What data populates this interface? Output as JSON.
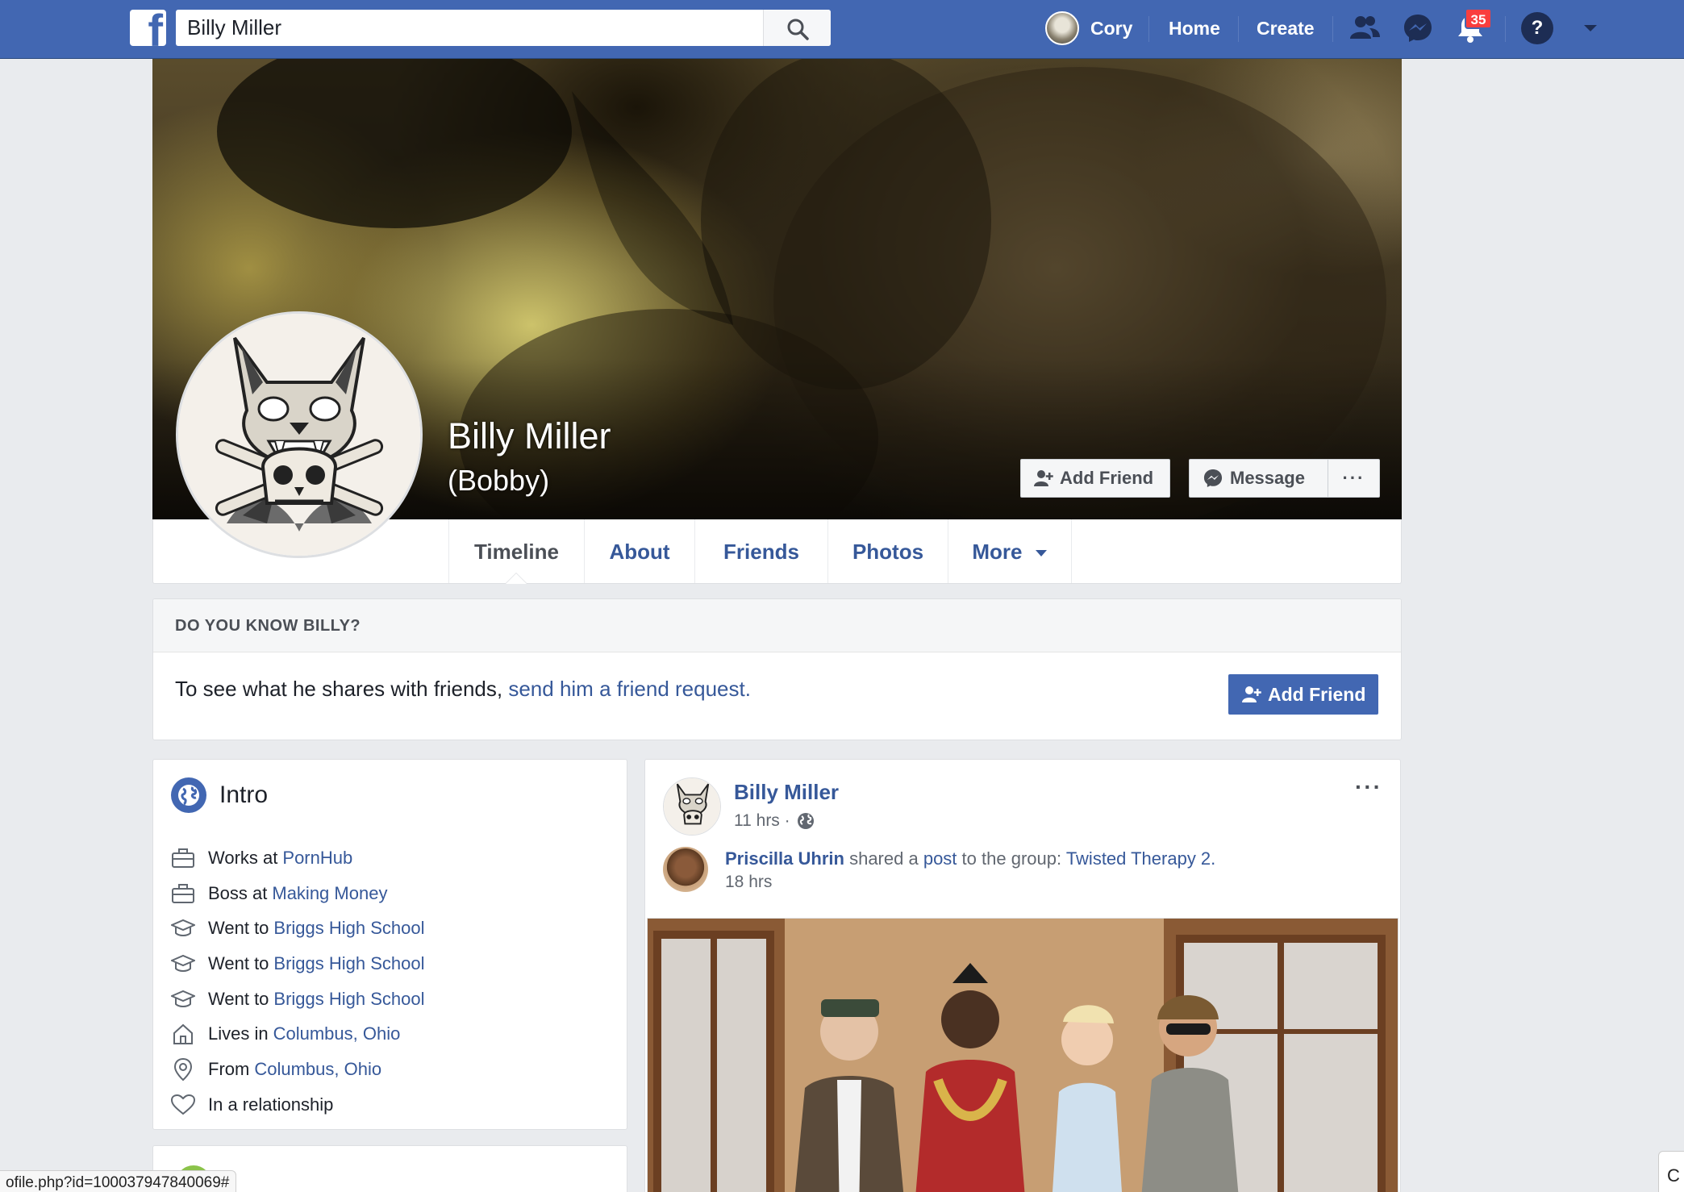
{
  "topbar": {
    "logo": "f",
    "search_value": "Billy Miller",
    "user_name": "Cory",
    "home_label": "Home",
    "create_label": "Create",
    "notification_count": "35",
    "help_symbol": "?"
  },
  "profile": {
    "name": "Billy Miller",
    "alternate_name": "(Bobby)",
    "add_friend_label": "Add Friend",
    "message_label": "Message",
    "more_dots": "···"
  },
  "tabs": [
    {
      "label": "Timeline"
    },
    {
      "label": "About"
    },
    {
      "label": "Friends"
    },
    {
      "label": "Photos"
    },
    {
      "label": "More"
    }
  ],
  "know": {
    "title": "DO YOU KNOW BILLY?",
    "text": "To see what he shares with friends,",
    "link": "send him a friend request.",
    "button": "Add Friend"
  },
  "intro": {
    "title": "Intro",
    "items": [
      {
        "icon": "briefcase-icon",
        "prefix": "Works at",
        "link": "PornHub"
      },
      {
        "icon": "briefcase-icon",
        "prefix": "Boss at",
        "link": "Making Money"
      },
      {
        "icon": "graduation-cap-icon",
        "prefix": "Went to",
        "link": "Briggs High School"
      },
      {
        "icon": "graduation-cap-icon",
        "prefix": "Went to",
        "link": "Briggs High School"
      },
      {
        "icon": "graduation-cap-icon",
        "prefix": "Went to",
        "link": "Briggs High School"
      },
      {
        "icon": "home-icon",
        "prefix": "Lives in",
        "link": "Columbus, Ohio"
      },
      {
        "icon": "location-pin-icon",
        "prefix": "From",
        "link": "Columbus, Ohio"
      },
      {
        "icon": "heart-icon",
        "prefix": "In a relationship",
        "link": ""
      }
    ]
  },
  "post": {
    "author": "Billy Miller",
    "time": "11 hrs ·",
    "more_dots": "···",
    "share": {
      "person": "Priscilla Uhrin",
      "verb": "shared a",
      "object": "post",
      "connector": "to the group:",
      "group": "Twisted Therapy 2.",
      "time": "18 hrs"
    }
  },
  "status_bar": {
    "url": "ofile.php?id=100037947840069#",
    "right_chip": "C"
  },
  "colors": {
    "brand": "#4267b2",
    "link": "#365899",
    "badge": "#fa3e3e"
  }
}
